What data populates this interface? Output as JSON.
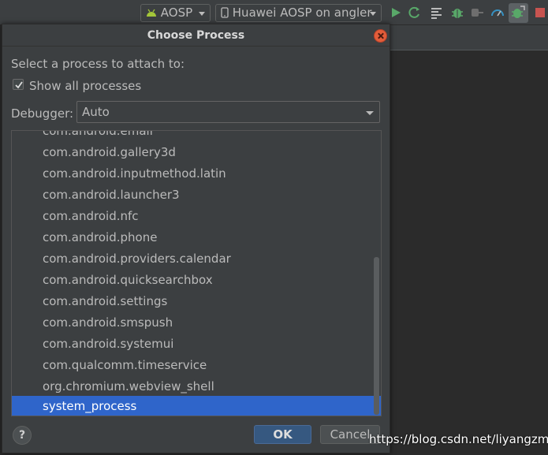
{
  "toolbar": {
    "module_combo": "AOSP",
    "device_combo": "Huawei AOSP on angler",
    "icons": [
      "run-icon",
      "apply-changes-icon",
      "logcat-icon",
      "debug-icon",
      "attach-icon",
      "profile-icon",
      "attach-debugger-icon",
      "stop-icon"
    ]
  },
  "dialog": {
    "title": "Choose Process",
    "prompt": "Select a process to attach to:",
    "show_all_label": "Show all processes",
    "show_all_checked": true,
    "debugger_label": "Debugger:",
    "debugger_value": "Auto",
    "processes": [
      "com.android.email",
      "com.android.gallery3d",
      "com.android.inputmethod.latin",
      "com.android.launcher3",
      "com.android.nfc",
      "com.android.phone",
      "com.android.providers.calendar",
      "com.android.quicksearchbox",
      "com.android.settings",
      "com.android.smspush",
      "com.android.systemui",
      "com.qualcomm.timeservice",
      "org.chromium.webview_shell",
      "system_process"
    ],
    "selected_process": "system_process",
    "help_label": "?",
    "ok_label": "OK",
    "cancel_label": "Cancel"
  },
  "watermark": "https://blog.csdn.net/liyangzmx",
  "colors": {
    "accent": "#2f65ca",
    "ok_button": "#365880",
    "close_button": "#e25d3a",
    "run_green": "#59a869",
    "background": "#3c3f41"
  }
}
